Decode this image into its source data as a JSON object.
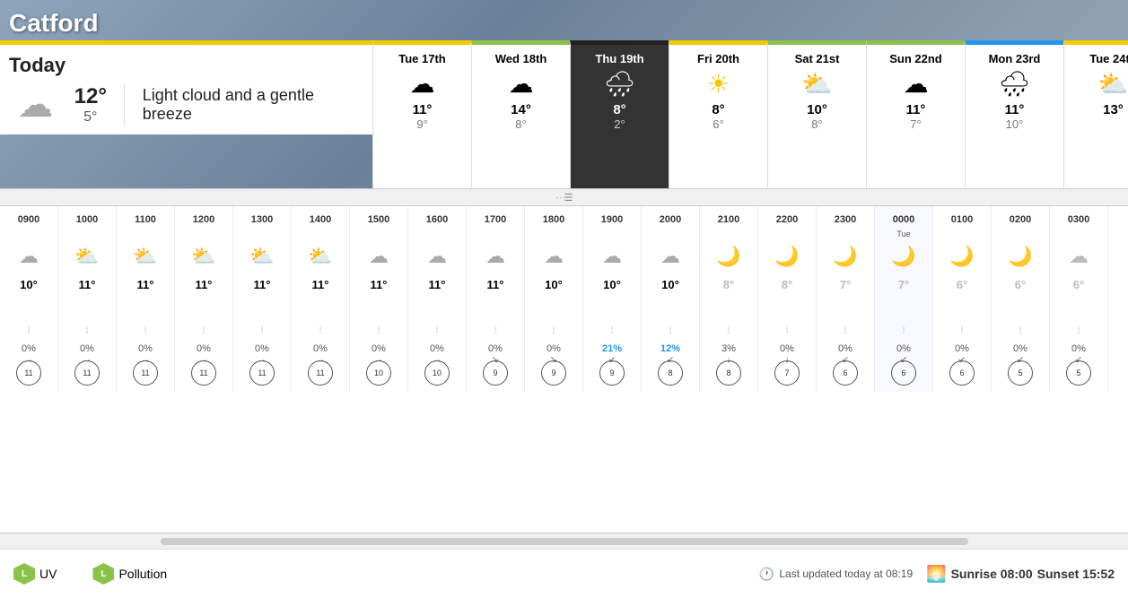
{
  "location": "Catford",
  "today": {
    "label": "Today",
    "max_temp": "12°",
    "min_temp": "5°",
    "description": "Light cloud and a gentle breeze",
    "icon": "☁"
  },
  "forecast_days": [
    {
      "id": "tue17",
      "label": "Tue 17th",
      "icon": "☁",
      "max": "11°",
      "min": "9°",
      "class": "tue"
    },
    {
      "id": "wed18",
      "label": "Wed 18th",
      "icon": "☁",
      "max": "14°",
      "min": "8°",
      "class": "wed"
    },
    {
      "id": "thu19",
      "label": "Thu 19th",
      "icon": "🌧",
      "max": "8°",
      "min": "2°",
      "class": "thu"
    },
    {
      "id": "fri20",
      "label": "Fri 20th",
      "icon": "☀",
      "max": "8°",
      "min": "6°",
      "class": "fri"
    },
    {
      "id": "sat21",
      "label": "Sat 21st",
      "icon": "⛅",
      "max": "10°",
      "min": "8°",
      "class": "sat"
    },
    {
      "id": "sun22",
      "label": "Sun 22nd",
      "icon": "☁",
      "max": "11°",
      "min": "7°",
      "class": "sun"
    },
    {
      "id": "mon23",
      "label": "Mon 23rd",
      "icon": "🌧",
      "max": "11°",
      "min": "10°",
      "class": "mon"
    },
    {
      "id": "tue24",
      "label": "Tue 24th",
      "icon": "⛅",
      "max": "13°",
      "min": "",
      "class": "tue2"
    }
  ],
  "hourly": [
    {
      "time": "0900",
      "day_label": "",
      "icon": "☁",
      "temp": "10°",
      "night": false,
      "precip_icon": "💧",
      "precip": "0%",
      "wind_speed": "11",
      "wind_dir": "→"
    },
    {
      "time": "1000",
      "day_label": "",
      "icon": "⛅",
      "temp": "11°",
      "night": false,
      "precip_icon": "💧",
      "precip": "0%",
      "wind_speed": "11",
      "wind_dir": "→"
    },
    {
      "time": "1100",
      "day_label": "",
      "icon": "⛅",
      "temp": "11°",
      "night": false,
      "precip_icon": "💧",
      "precip": "0%",
      "wind_speed": "11",
      "wind_dir": "→"
    },
    {
      "time": "1200",
      "day_label": "",
      "icon": "⛅",
      "temp": "11°",
      "night": false,
      "precip_icon": "💧",
      "precip": "0%",
      "wind_speed": "11",
      "wind_dir": "→"
    },
    {
      "time": "1300",
      "day_label": "",
      "icon": "⛅",
      "temp": "11°",
      "night": false,
      "precip_icon": "💧",
      "precip": "0%",
      "wind_speed": "11",
      "wind_dir": "→"
    },
    {
      "time": "1400",
      "day_label": "",
      "icon": "⛅",
      "temp": "11°",
      "night": false,
      "precip_icon": "💧",
      "precip": "0%",
      "wind_speed": "11",
      "wind_dir": "→"
    },
    {
      "time": "1500",
      "day_label": "",
      "icon": "☁",
      "temp": "11°",
      "night": false,
      "precip_icon": "💧",
      "precip": "0%",
      "wind_speed": "10",
      "wind_dir": "→"
    },
    {
      "time": "1600",
      "day_label": "",
      "icon": "☁",
      "temp": "11°",
      "night": false,
      "precip_icon": "💧",
      "precip": "0%",
      "wind_speed": "10",
      "wind_dir": "→"
    },
    {
      "time": "1700",
      "day_label": "",
      "icon": "☁",
      "temp": "11°",
      "night": false,
      "precip_icon": "💧",
      "precip": "0%",
      "wind_speed": "9",
      "wind_dir": "↘"
    },
    {
      "time": "1800",
      "day_label": "",
      "icon": "☁",
      "temp": "10°",
      "night": false,
      "precip_icon": "💧",
      "precip": "0%",
      "wind_speed": "9",
      "wind_dir": "↘"
    },
    {
      "time": "1900",
      "day_label": "",
      "icon": "☁",
      "temp": "10°",
      "night": false,
      "precip_icon": "💧",
      "precip": "21%",
      "precip_highlight": true,
      "wind_speed": "9",
      "wind_dir": "↙"
    },
    {
      "time": "2000",
      "day_label": "",
      "icon": "☁",
      "temp": "10°",
      "night": false,
      "precip_icon": "💧",
      "precip": "12%",
      "precip_highlight": true,
      "wind_speed": "8",
      "wind_dir": "↙"
    },
    {
      "time": "2100",
      "day_label": "",
      "icon": "🌙",
      "temp": "8°",
      "night": true,
      "precip_icon": "💧",
      "precip": "3%",
      "wind_speed": "8",
      "wind_dir": "↓"
    },
    {
      "time": "2200",
      "day_label": "",
      "icon": "🌙",
      "temp": "8°",
      "night": true,
      "precip_icon": "💧",
      "precip": "0%",
      "wind_speed": "7",
      "wind_dir": "↓"
    },
    {
      "time": "2300",
      "day_label": "",
      "icon": "🌙",
      "temp": "7°",
      "night": true,
      "precip_icon": "💧",
      "precip": "0%",
      "wind_speed": "6",
      "wind_dir": "↙"
    },
    {
      "time": "0000",
      "day_label": "Tue",
      "icon": "🌙",
      "temp": "7°",
      "night": true,
      "precip_icon": "💧",
      "precip": "0%",
      "wind_speed": "6",
      "wind_dir": "↙"
    },
    {
      "time": "0100",
      "day_label": "",
      "icon": "🌙",
      "temp": "6°",
      "night": true,
      "precip_icon": "💧",
      "precip": "0%",
      "wind_speed": "6",
      "wind_dir": "↙"
    },
    {
      "time": "0200",
      "day_label": "",
      "icon": "🌙",
      "temp": "6°",
      "night": true,
      "precip_icon": "💧",
      "precip": "0%",
      "wind_speed": "5",
      "wind_dir": "↙"
    },
    {
      "time": "0300",
      "day_label": "",
      "icon": "☁",
      "temp": "6°",
      "night": true,
      "precip_icon": "💧",
      "precip": "0%",
      "wind_speed": "5",
      "wind_dir": "↙"
    }
  ],
  "bottom": {
    "uv_label": "L",
    "uv_text": "UV",
    "pollution_label": "L",
    "pollution_text": "Pollution",
    "last_updated": "Last updated today at 08:19",
    "sunrise": "Sunrise 08:00",
    "sunset": "Sunset 15:52"
  }
}
